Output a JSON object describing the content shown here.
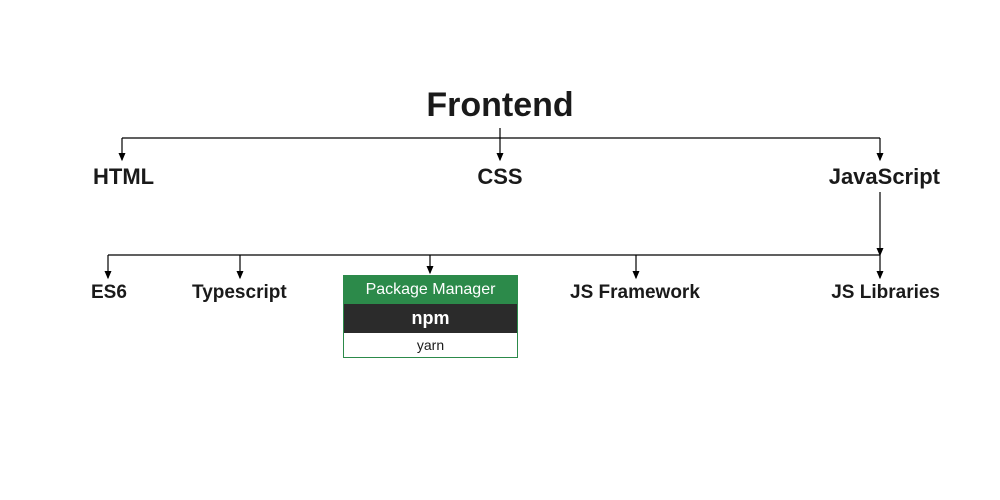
{
  "root": "Frontend",
  "level1": {
    "html": "HTML",
    "css": "CSS",
    "js": "JavaScript"
  },
  "level2": {
    "es6": "ES6",
    "typescript": "Typescript",
    "package_manager": {
      "title": "Package Manager",
      "npm": "npm",
      "yarn": "yarn"
    },
    "framework": "JS Framework",
    "libraries": "JS Libraries"
  }
}
